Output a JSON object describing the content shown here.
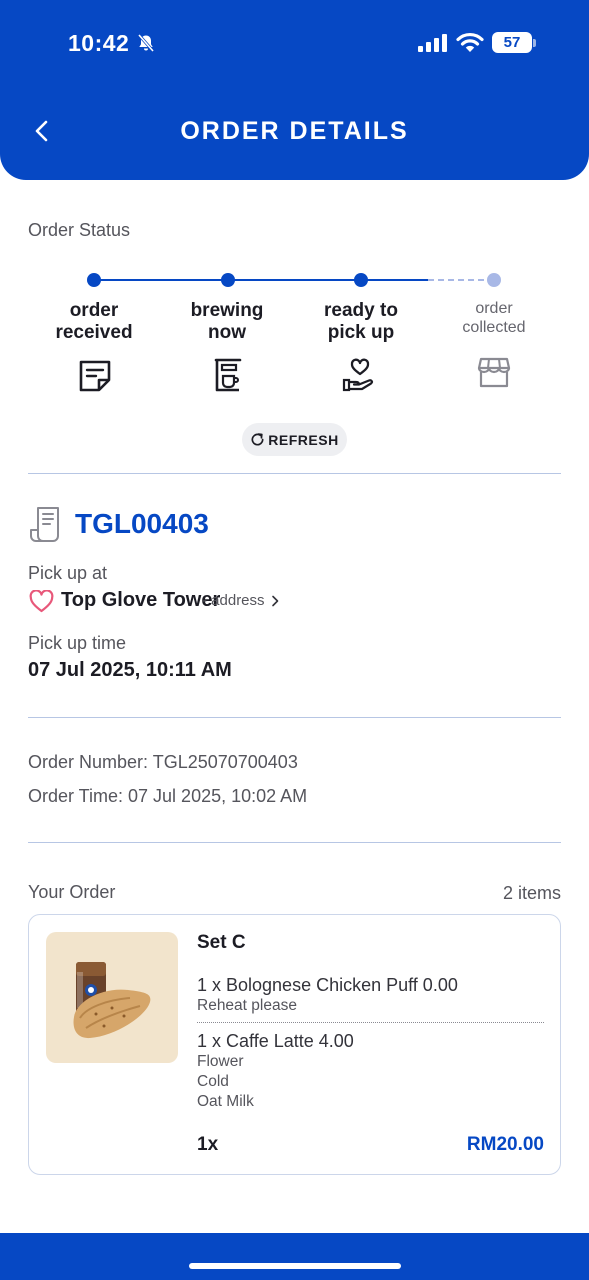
{
  "status_bar": {
    "time": "10:42",
    "battery": "57"
  },
  "header": {
    "title": "ORDER DETAILS"
  },
  "order_status": {
    "label": "Order Status",
    "steps": [
      {
        "label": "order received",
        "line1": "order",
        "line2": "received",
        "icon": "note-icon",
        "done": true
      },
      {
        "label": "brewing now",
        "line1": "brewing",
        "line2": "now",
        "icon": "coffee-machine-icon",
        "done": true
      },
      {
        "label": "ready to pick up",
        "line1": "ready to",
        "line2": "pick up",
        "icon": "hand-heart-icon",
        "done": true
      },
      {
        "label": "order collected",
        "line1": "order",
        "line2": "collected",
        "icon": "store-icon",
        "done": false
      }
    ],
    "refresh_label": "REFRESH"
  },
  "pickup": {
    "order_code": "TGL00403",
    "pickup_at_label": "Pick up at",
    "store_name": "Top Glove Tower",
    "address_label": "- address",
    "pickup_time_label": "Pick up time",
    "pickup_time": "07 Jul 2025, 10:11 AM"
  },
  "meta": {
    "order_number": "Order Number: TGL25070700403",
    "order_time": "Order Time: 07 Jul 2025, 10:02 AM"
  },
  "your_order": {
    "label": "Your Order",
    "count": "2 items",
    "item": {
      "name": "Set C",
      "lines": [
        {
          "title": "1 x Bolognese Chicken Puff 0.00",
          "notes": [
            "Reheat please"
          ]
        },
        {
          "title": "1 x Caffe Latte 4.00",
          "notes": [
            "Flower",
            "Cold",
            "Oat Milk"
          ]
        }
      ],
      "quantity": "1x",
      "price": "RM20.00"
    }
  },
  "colors": {
    "brand": "#0648c4",
    "pending": "#a8b8e6",
    "accent_heart": "#e8587a"
  }
}
